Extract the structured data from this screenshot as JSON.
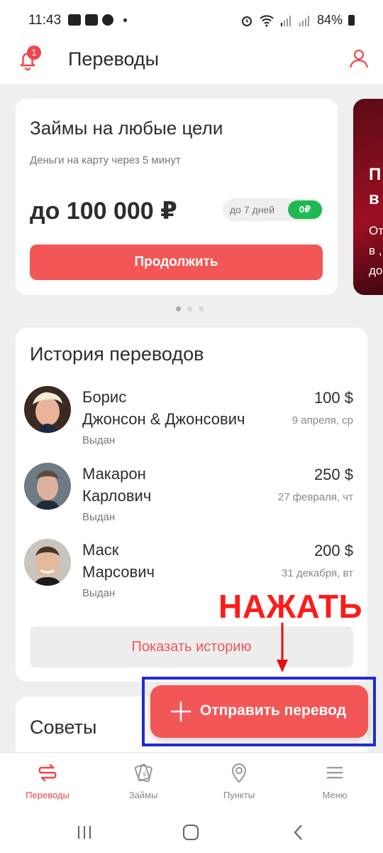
{
  "status_bar": {
    "time": "11:43",
    "battery": "84%"
  },
  "header": {
    "title": "Переводы",
    "notification_count": "1"
  },
  "promo": {
    "title": "Займы на любые цели",
    "subtitle": "Деньги на карту через 5 минут",
    "amount": "до 100 000 ₽",
    "term": "до 7 дней",
    "rate": "0₽",
    "button": "Продолжить"
  },
  "promo2": {
    "title_partial": "П\nв",
    "sub_partial": "От\nв ,\nдо"
  },
  "history": {
    "title": "История переводов",
    "items": [
      {
        "name": "Борис\nДжонсон & Джонсович",
        "amount": "100 $",
        "date": "9 апреля, ср",
        "status": "Выдан"
      },
      {
        "name": "Макарон\nКарлович",
        "amount": "250 $",
        "date": "27 февраля, чт",
        "status": "Выдан"
      },
      {
        "name": "Маск\nМарсович",
        "amount": "200 $",
        "date": "31 декабря, вт",
        "status": "Выдан"
      }
    ],
    "show_button": "Показать историю"
  },
  "tips": {
    "title": "Советы"
  },
  "annotation": {
    "text": "НАЖАТЬ",
    "color": "#ff1a1a"
  },
  "fab": {
    "label": "Отправить перевод"
  },
  "bottom_nav": {
    "items": [
      {
        "label": "Переводы",
        "icon": "transfers-icon",
        "active": true
      },
      {
        "label": "Займы",
        "icon": "loans-icon",
        "active": false
      },
      {
        "label": "Пункты",
        "icon": "location-pin-icon",
        "active": false
      },
      {
        "label": "Меню",
        "icon": "menu-icon",
        "active": false
      }
    ]
  },
  "colors": {
    "accent": "#f25657",
    "success": "#1fb954",
    "highlight": "#1f2bd6"
  }
}
